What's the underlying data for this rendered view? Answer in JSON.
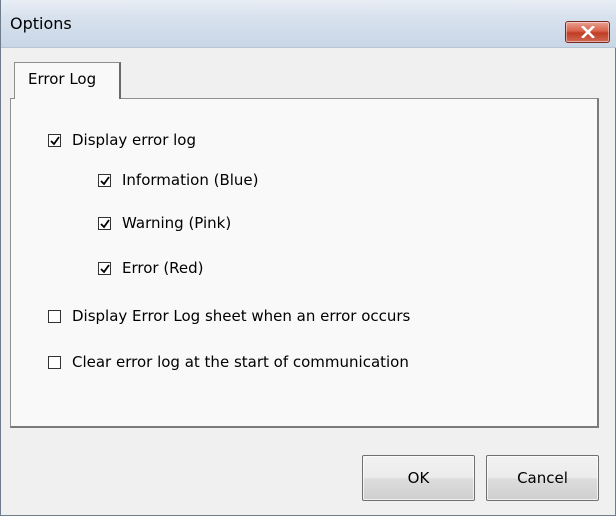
{
  "window": {
    "title": "Options"
  },
  "icons": {
    "close": "close-icon",
    "check": "checkmark-icon"
  },
  "colors": {
    "close_button": "#c94a33",
    "titlebar": "#d8e2ee"
  },
  "tabs": [
    {
      "label": "Error Log",
      "selected": true
    }
  ],
  "options": [
    {
      "label": "Display error log",
      "checked": true
    },
    {
      "label": "Information (Blue)",
      "checked": true
    },
    {
      "label": "Warning (Pink)",
      "checked": true
    },
    {
      "label": "Error (Red)",
      "checked": true
    },
    {
      "label": "Display Error Log sheet when an error occurs",
      "checked": false
    },
    {
      "label": "Clear error log at the start of communication",
      "checked": false
    }
  ],
  "buttons": {
    "ok": "OK",
    "cancel": "Cancel"
  }
}
